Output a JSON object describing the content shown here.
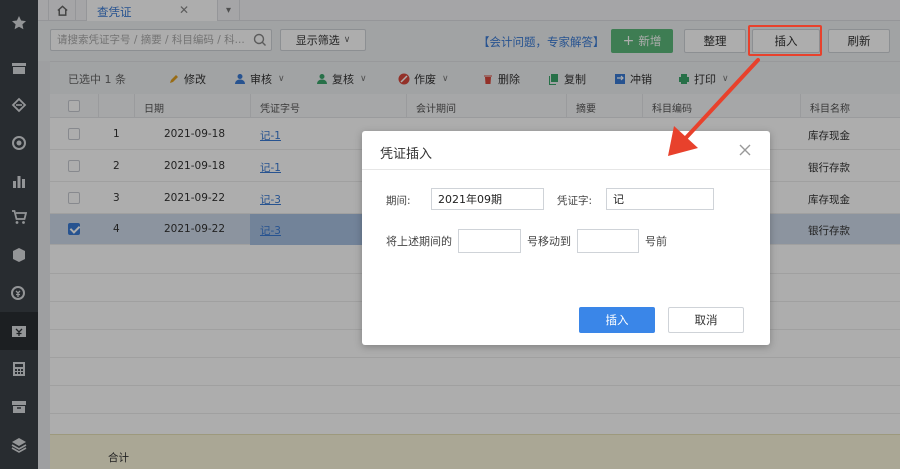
{
  "tabs": {
    "active_label": "查凭证",
    "close_glyph": "✕"
  },
  "toolbar": {
    "search_placeholder": "请搜索凭证字号 / 摘要 / 科目编码 / 科...",
    "filter_label": "显示筛选",
    "help_link": "【会计问题，专家解答】",
    "add_label": "新增",
    "organize_label": "整理",
    "insert_label": "插入",
    "refresh_label": "刷新"
  },
  "actions": {
    "selected_count": "已选中 1 条",
    "edit": "修改",
    "audit": "审核",
    "review": "复核",
    "void": "作废",
    "delete": "删除",
    "copy": "复制",
    "reverse": "冲销",
    "print": "打印"
  },
  "table": {
    "headers": [
      "日期",
      "凭证字号",
      "会计期间",
      "摘要",
      "科目编码",
      "科目名称"
    ],
    "rows": [
      {
        "index": "1",
        "date": "2021-09-18",
        "voucher": "记-1",
        "account_name": "库存现金",
        "checked": false
      },
      {
        "index": "2",
        "date": "2021-09-18",
        "voucher": "记-1",
        "account_name": "银行存款",
        "checked": false
      },
      {
        "index": "3",
        "date": "2021-09-22",
        "voucher": "记-3",
        "account_name": "库存现金",
        "checked": false
      },
      {
        "index": "4",
        "date": "2021-09-22",
        "voucher": "记-3",
        "account_name": "银行存款",
        "checked": true
      }
    ],
    "footer_label": "合计"
  },
  "dialog": {
    "title": "凭证插入",
    "period_label": "期间:",
    "period_value": "2021年09期",
    "voucher_word_label": "凭证字:",
    "voucher_word_value": "记",
    "move_prefix": "将上述期间的",
    "move_middle": "号移动到",
    "move_suffix": "号前",
    "from_value": "",
    "to_value": "",
    "insert_label": "插入",
    "cancel_label": "取消"
  },
  "colors": {
    "accent": "#3a7bd5",
    "add_green": "#5cb87b",
    "annotation_red": "#e8412c",
    "sidebar": "#3c4147"
  }
}
